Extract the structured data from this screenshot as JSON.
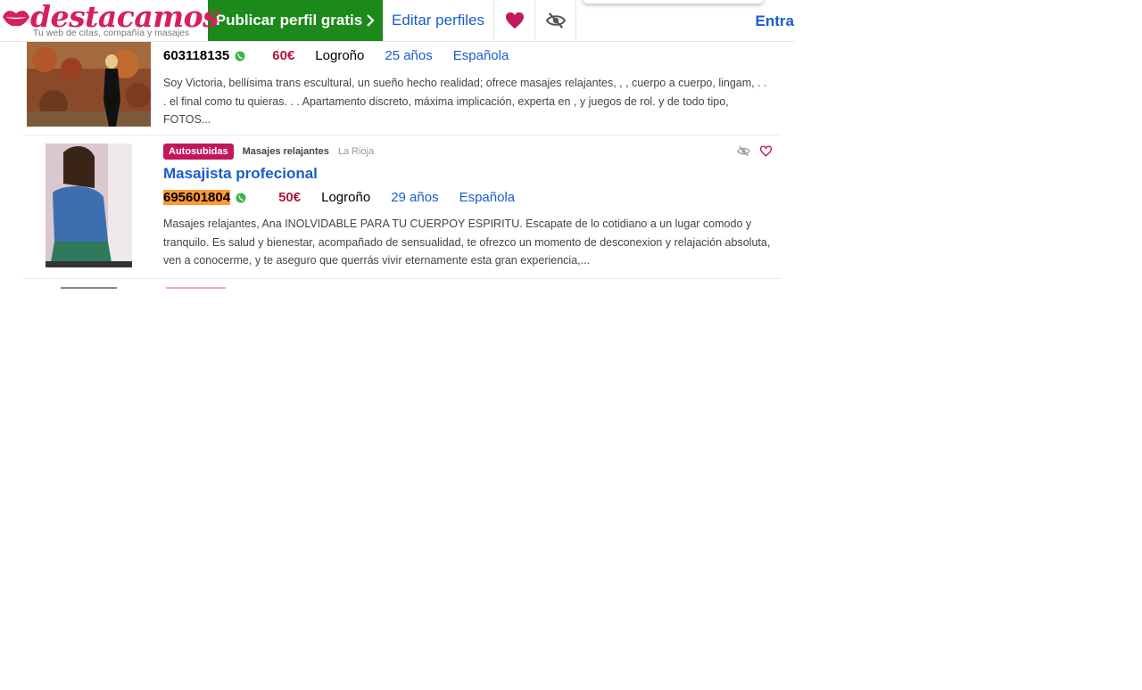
{
  "header": {
    "logo_text": "destacamos",
    "logo_tagline": "Tu web de citas, compañía y masajes",
    "publish_label": "Publicar perfil gratis",
    "edit_label": "Editar perfiles",
    "login_label": "Entra",
    "icons": [
      "heart-icon",
      "eye-slash-icon"
    ],
    "accent_color": "#d61f5d",
    "publish_color": "#1b8a1b"
  },
  "listings": [
    {
      "phone": "603118135",
      "price": "60€",
      "city": "Logroño",
      "age": "25 años",
      "nationality": "Española",
      "description": "Soy Victoria, bellísima trans escultural, un sueño hecho realidad; ofrece masajes relajantes, , , cuerpo a cuerpo, lingam, . . . el final como tu quieras. . . Apartamento discreto, máxima implicación, experta en , y juegos de rol. y de todo tipo, FOTOS..."
    },
    {
      "tag": "Autosubidas",
      "category": "Masajes relajantes",
      "region": "La Rioja",
      "title": "Masajista profecional",
      "phone": "695601804",
      "price": "50€",
      "city": "Logroño",
      "age": "29 años",
      "nationality": "Española",
      "description": "Masajes relajantes, Ana INOLVIDABLE PARA TU CUERPOY ESPIRITU. Escapate de lo cotidiano a un lugar comodo y tranquilo. Es salud y bienestar, acompañado de sensualidad, te ofrezco un momento de desconexion y relajación absoluta, ven a conocerme, y te aseguro que querrás vivir eternamente esta gran experiencia,..."
    }
  ]
}
